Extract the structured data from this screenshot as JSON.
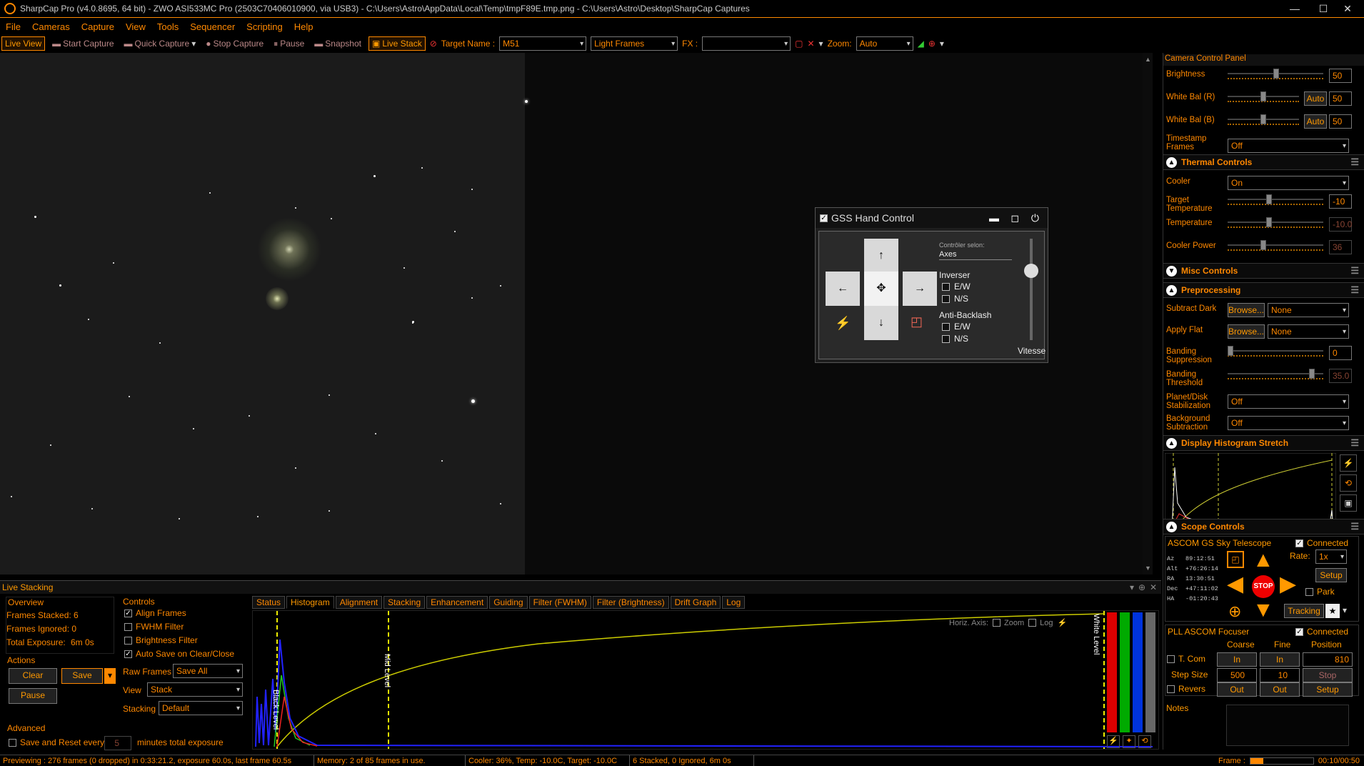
{
  "window": {
    "title": "SharpCap Pro (v4.0.8695, 64 bit) - ZWO ASI533MC Pro (2503C70406010900, via USB3) - C:\\Users\\Astro\\AppData\\Local\\Temp\\tmpF89E.tmp.png - C:\\Users\\Astro\\Desktop\\SharpCap Captures",
    "minimize": "—",
    "maximize": "☐",
    "close": "✕"
  },
  "menu": [
    "File",
    "Cameras",
    "Capture",
    "View",
    "Tools",
    "Sequencer",
    "Scripting",
    "Help"
  ],
  "toolbar": {
    "live_view": "Live View",
    "start_capture": "Start Capture",
    "quick_capture": "Quick Capture",
    "stop_capture": "Stop Capture",
    "pause": "Pause",
    "snapshot": "Snapshot",
    "live_stack": "Live Stack",
    "target_name_label": "Target Name :",
    "target_name": "M51",
    "frame_type": "Light Frames",
    "fx_label": "FX :",
    "fx_value": "",
    "zoom_label": "Zoom:",
    "zoom_value": "Auto"
  },
  "camera_panel": {
    "title": "Camera Control Panel",
    "brightness": {
      "label": "Brightness",
      "value": "50"
    },
    "wb_r": {
      "label": "White Bal (R)",
      "auto": "Auto",
      "value": "50"
    },
    "wb_b": {
      "label": "White Bal (B)",
      "auto": "Auto",
      "value": "50"
    },
    "timestamp": {
      "label": "Timestamp Frames",
      "value": "Off"
    }
  },
  "thermal": {
    "title": "Thermal Controls",
    "cooler": {
      "label": "Cooler",
      "value": "On"
    },
    "target_temp": {
      "label": "Target Temperature",
      "value": "-10"
    },
    "temperature": {
      "label": "Temperature",
      "value": "-10.0"
    },
    "cooler_power": {
      "label": "Cooler Power",
      "value": "36"
    }
  },
  "misc": {
    "title": "Misc Controls"
  },
  "preprocessing": {
    "title": "Preprocessing",
    "subtract_dark": {
      "label": "Subtract Dark",
      "browse": "Browse...",
      "value": "None"
    },
    "apply_flat": {
      "label": "Apply Flat",
      "browse": "Browse...",
      "value": "None"
    },
    "banding_suppression": {
      "label": "Banding Suppression",
      "value": "0"
    },
    "banding_threshold": {
      "label": "Banding Threshold",
      "value": "35.0"
    },
    "planet_stab": {
      "label": "Planet/Disk Stabilization",
      "value": "Off"
    },
    "bg_sub": {
      "label": "Background Subtraction",
      "value": "Off"
    }
  },
  "histogram_stretch": {
    "title": "Display Histogram Stretch"
  },
  "scope": {
    "title": "Scope Controls",
    "telescope": "ASCOM GS Sky Telescope",
    "connected": "Connected",
    "rate_label": "Rate:",
    "rate": "1x",
    "setup": "Setup",
    "park": "Park",
    "tracking": "Tracking",
    "stop": "STOP",
    "coords": [
      {
        "k": "Az",
        "v": "89:12:51"
      },
      {
        "k": "Alt",
        "v": "+76:26:14"
      },
      {
        "k": "RA",
        "v": "13:30:51"
      },
      {
        "k": "Dec",
        "v": "+47:11:02"
      },
      {
        "k": "HA",
        "v": "-01:20:43"
      }
    ]
  },
  "focuser": {
    "name": "PLL ASCOM Focuser",
    "connected": "Connected",
    "coarse": "Coarse",
    "fine": "Fine",
    "position_label": "Position",
    "position": "810",
    "tcomp": "T. Com",
    "in": "In",
    "out": "Out",
    "step_label": "Step Size",
    "step_coarse": "500",
    "step_fine": "10",
    "stop": "Stop",
    "reverse": "Revers",
    "setup": "Setup"
  },
  "notes": {
    "label": "Notes"
  },
  "gss": {
    "title": "GSS Hand Control",
    "controller_label": "Contrôler selon:",
    "controller_value": "Axes",
    "inverser": "Inverser",
    "ew": "E/W",
    "ns": "N/S",
    "anti_backlash": "Anti-Backlash",
    "speed": "Vitesse",
    "up": "↑",
    "down": "↓",
    "left": "←",
    "right": "→",
    "center": "✥"
  },
  "live_stacking": {
    "title": "Live Stacking",
    "overview_title": "Overview",
    "frames_stacked": "Frames Stacked: 6",
    "frames_ignored": "Frames Ignored: 0",
    "total_exposure_label": "Total Exposure:",
    "total_exposure": "6m 0s",
    "actions_title": "Actions",
    "clear": "Clear",
    "save": "Save",
    "pause": "Pause",
    "controls_title": "Controls",
    "align_frames": "Align Frames",
    "fwhm_filter": "FWHM Filter",
    "brightness_filter": "Brightness Filter",
    "auto_save": "Auto Save on Clear/Close",
    "raw_frames_label": "Raw Frames",
    "raw_frames": "Save All",
    "view_label": "View",
    "view": "Stack",
    "stacking_label": "Stacking",
    "stacking": "Default",
    "advanced_title": "Advanced",
    "save_reset": "Save and Reset every",
    "save_reset_value": "5",
    "minutes_total": "minutes total exposure",
    "tabs": [
      "Status",
      "Histogram",
      "Alignment",
      "Stacking",
      "Enhancement",
      "Guiding",
      "Filter (FWHM)",
      "Filter (Brightness)",
      "Drift Graph",
      "Log"
    ],
    "horiz_axis": "Horiz. Axis:",
    "zoom": "Zoom",
    "log": "Log",
    "black_level": "Black Level",
    "mid_level": "Mid Level",
    "white_level": "White Level"
  },
  "status": {
    "previewing": "Previewing : 276 frames (0 dropped) in 0:33:21.2, exposure 60.0s, last frame 60.5s",
    "memory": "Memory: 2 of 85 frames in use.",
    "cooler": "Cooler: 36%, Temp: -10.0C, Target: -10.0C",
    "stacked": "6 Stacked, 0 Ignored, 6m 0s",
    "frame_label": "Frame :",
    "frame_time": "00:10/00:50"
  },
  "colors": {
    "accent": "#ff9900",
    "background": "#000000",
    "panel": "#0b0b0b"
  }
}
